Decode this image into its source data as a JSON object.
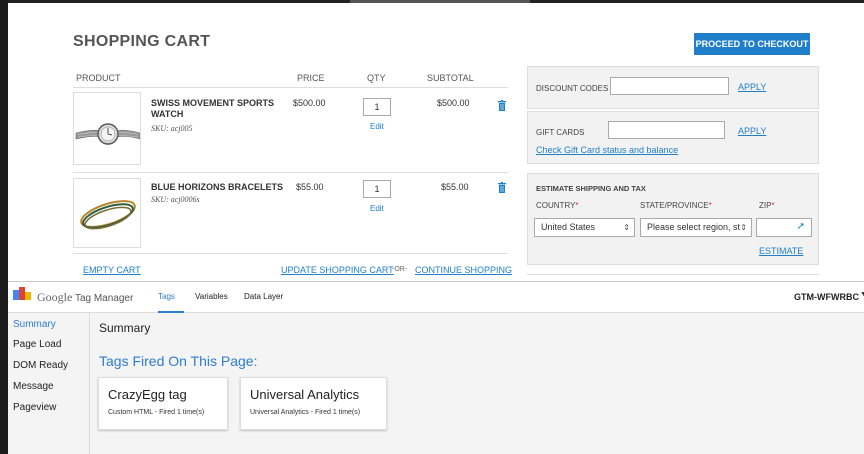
{
  "cart": {
    "title": "SHOPPING CART",
    "checkout_label": "PROCEED TO CHECKOUT",
    "columns": [
      "PRODUCT",
      "PRICE",
      "QTY",
      "SUBTOTAL"
    ],
    "items": [
      {
        "name": "SWISS MOVEMENT SPORTS WATCH",
        "sku": "SKU: acj005",
        "price": "$500.00",
        "qty": "1",
        "edit": "Edit",
        "subtotal": "$500.00",
        "image_icon": "watch-image"
      },
      {
        "name": "BLUE HORIZONS BRACELETS",
        "sku": "SKU: acj0006s",
        "price": "$55.00",
        "qty": "1",
        "edit": "Edit",
        "subtotal": "$55.00",
        "image_icon": "bracelets-image"
      }
    ],
    "empty_cart": "EMPTY CART",
    "update_cart": "UPDATE SHOPPING CART",
    "or": "-OR-",
    "continue": "CONTINUE SHOPPING"
  },
  "sidebar": {
    "discount_label": "DISCOUNT CODES",
    "apply": "APPLY",
    "gift_label": "GIFT CARDS",
    "gift_link": "Check Gift Card status and balance",
    "ship_title": "ESTIMATE SHIPPING AND TAX",
    "country_label": "COUNTRY",
    "state_label": "STATE/PROVINCE",
    "zip_label": "ZIP",
    "country_value": "United States",
    "state_value": "Please select region, st",
    "estimate": "ESTIMATE"
  },
  "gtm": {
    "brand_google": "Google",
    "brand_name": "Tag Manager",
    "tabs": [
      "Tags",
      "Variables",
      "Data Layer"
    ],
    "active_tab": "Tags",
    "container_id": "GTM-WFWRBC",
    "nav": [
      "Summary",
      "Page Load",
      "DOM Ready",
      "Message",
      "Pageview"
    ],
    "active_nav": "Summary",
    "summary_heading": "Summary",
    "fired_heading": "Tags Fired On This Page:",
    "tags": [
      {
        "name": "CrazyEgg tag",
        "meta": "Custom HTML - Fired 1 time(s)"
      },
      {
        "name": "Universal Analytics",
        "meta": "Universal Analytics - Fired 1 time(s)"
      }
    ]
  },
  "colors": {
    "accent": "#1f7fc9",
    "gtm_blue": "#2d7dd2",
    "required": "#cc3333"
  }
}
